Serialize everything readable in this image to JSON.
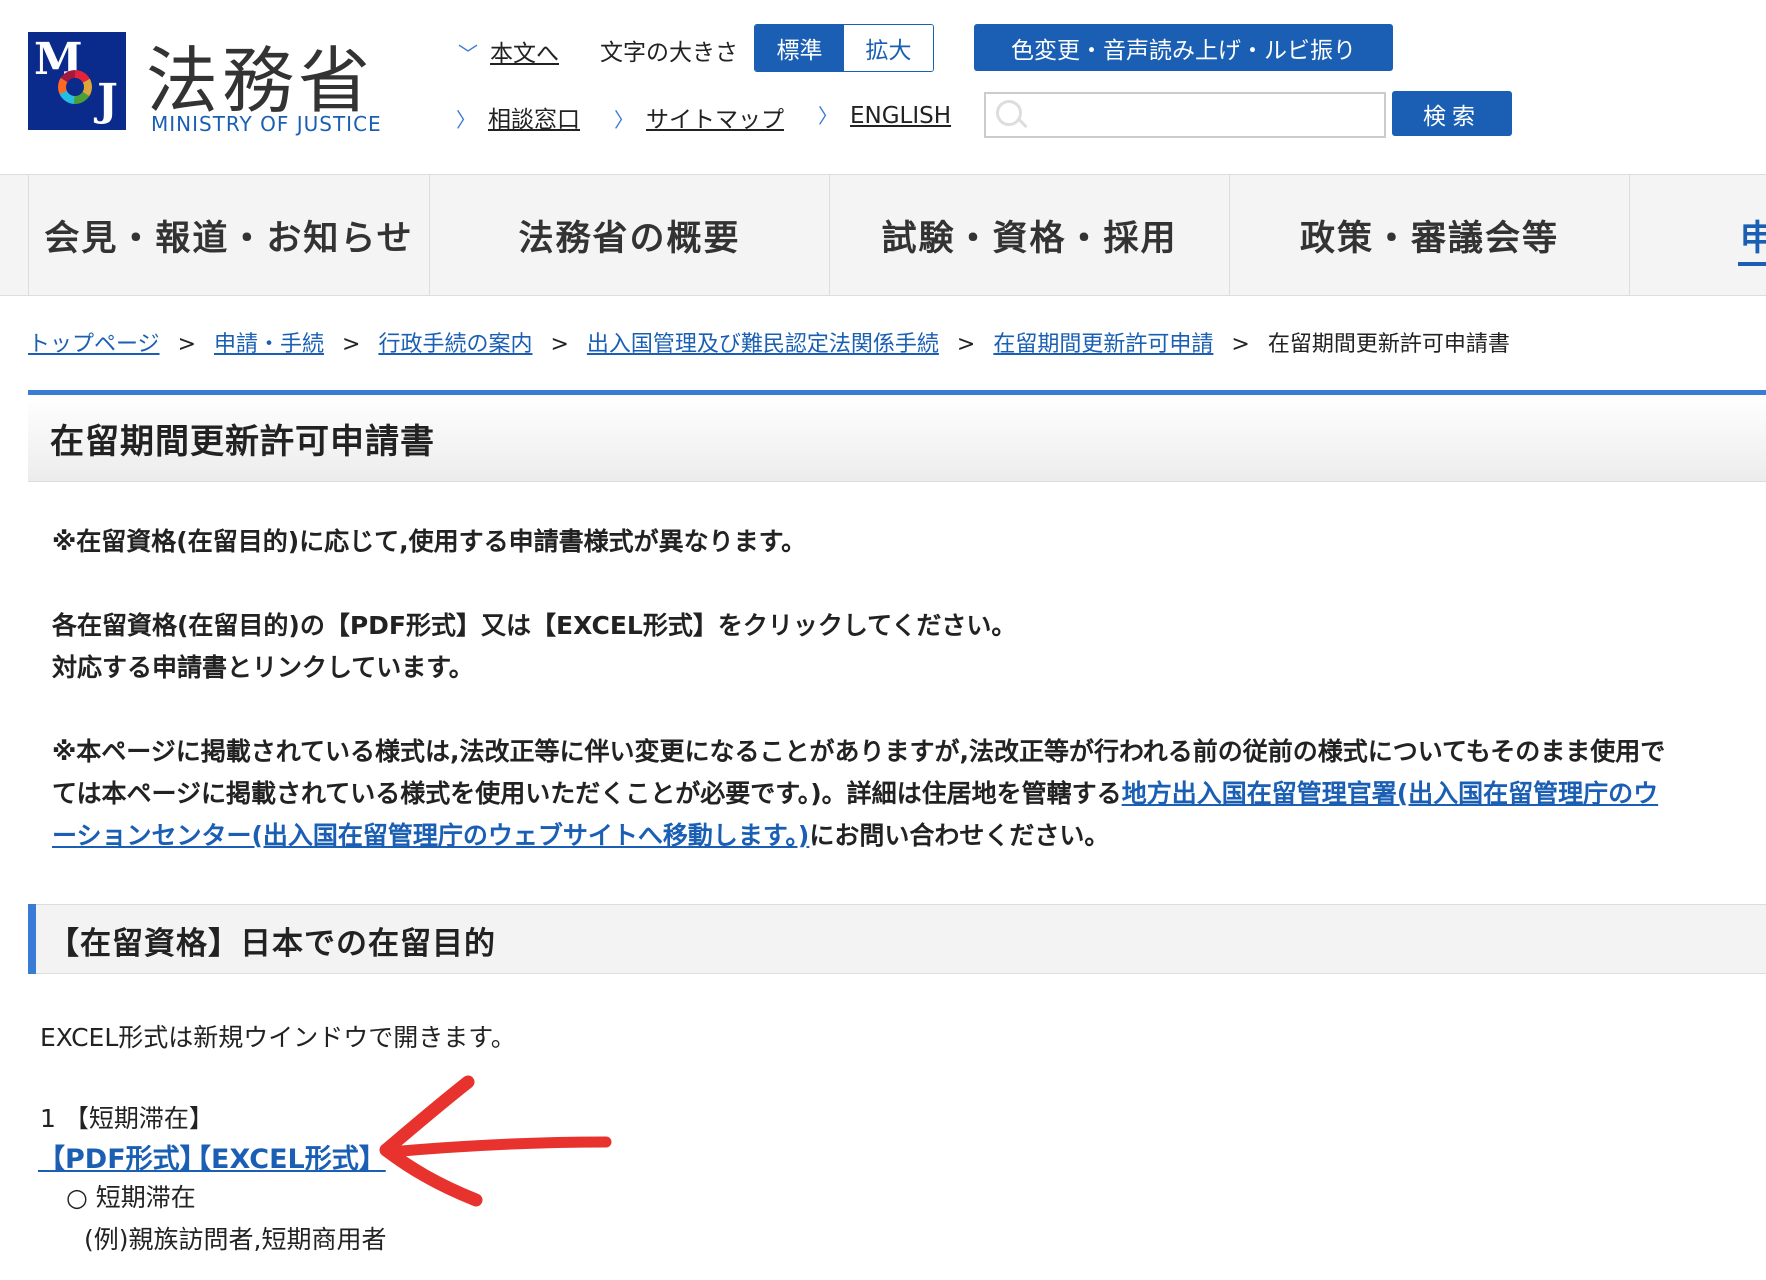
{
  "header": {
    "title": "法務省",
    "subtitle": "MINISTRY OF JUSTICE",
    "logo_letters": {
      "m": "M",
      "j": "J"
    },
    "skip_link": "本文へ",
    "font_size_label": "文字の大きさ",
    "font_size_standard": "標準",
    "font_size_large": "拡大",
    "color_button": "色変更・音声読み上げ・ルビ振り",
    "consult_link": "相談窓口",
    "sitemap_link": "サイトマップ",
    "english_link": "ENGLISH",
    "search_placeholder": "",
    "search_button": "検索",
    "accent": "#1a5fb4"
  },
  "nav": {
    "items": [
      "会見・報道・お知らせ",
      "法務省の概要",
      "試験・資格・採用",
      "政策・審議会等",
      "申"
    ]
  },
  "breadcrumb": {
    "items": [
      "トップページ",
      "申請・手続",
      "行政手続の案内",
      "出入国管理及び難民認定法関係手続",
      "在留期間更新許可申請"
    ],
    "current": "在留期間更新許可申請書",
    "separator": ">"
  },
  "page": {
    "title": "在留期間更新許可申請書",
    "note1": "※在留資格(在留目的)に応じて,使用する申請書様式が異なります。",
    "note2_line1": "各在留資格(在留目的)の【PDF形式】又は【EXCEL形式】をクリックしてください。",
    "note2_line2": "対応する申請書とリンクしています。",
    "note3_line1": "※本ページに掲載されている様式は,法改正等に伴い変更になることがありますが,法改正等が行われる前の従前の様式についてもそのまま使用で",
    "note3_line2_text": "ては本ページに掲載されている様式を使用いただくことが必要です。)。詳細は住居地を管轄する",
    "note3_line2_link": "地方出入国在留管理官署(出入国在留管理庁のウ",
    "note3_line3_link": "ーションセンター(出入国在留管理庁のウェブサイトへ移動します。)",
    "note3_line3_text": "にお問い合わせください。"
  },
  "section": {
    "title": "【在留資格】日本での在留目的",
    "excel_note": "EXCEL形式は新規ウインドウで開きます。",
    "item_number": "1",
    "item_title": "【短期滞在】",
    "pdf_link": "【PDF形式】",
    "excel_link": "【EXCEL形式】",
    "bullet": "○",
    "item_name": "短期滞在",
    "example": "(例)親族訪問者,短期商用者"
  },
  "annotation": {
    "arrow_color": "#e8322d"
  }
}
